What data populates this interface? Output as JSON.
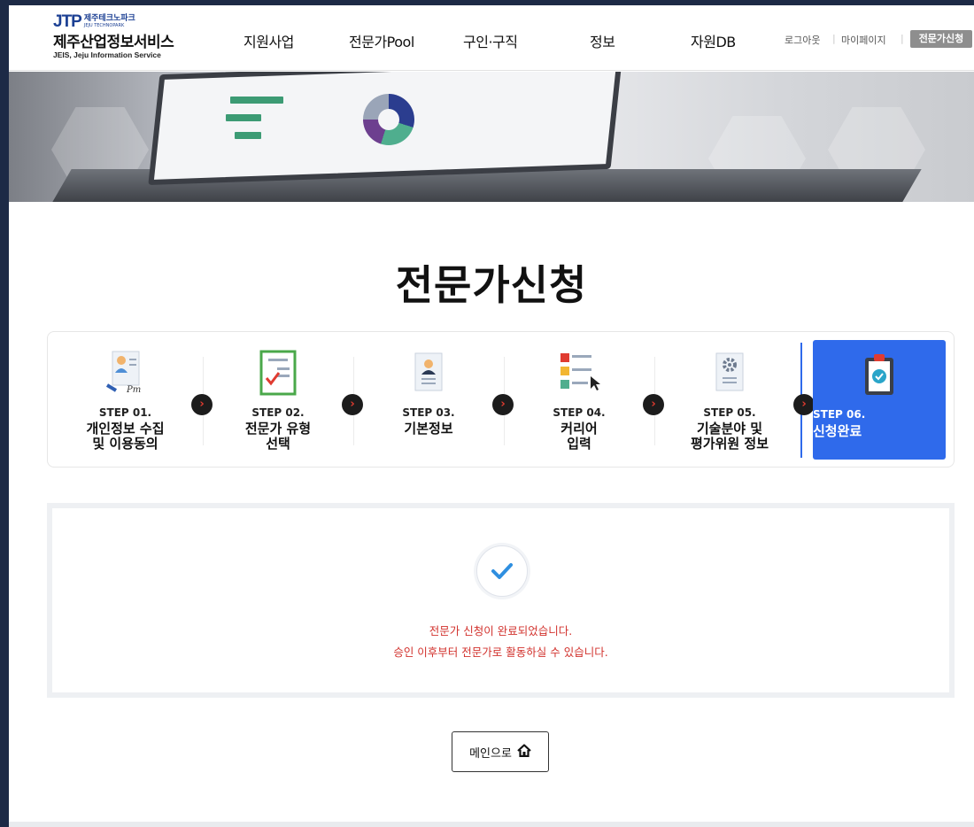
{
  "header": {
    "logo": {
      "jtp": "JTP",
      "park_kr": "제주테크노파크",
      "park_en": "JEJU TECHNOPARK",
      "name": "제주산업정보서비스",
      "sub": "JEIS, Jeju Information Service"
    },
    "nav": [
      {
        "label": "지원사업"
      },
      {
        "label": "전문가Pool"
      },
      {
        "label": "구인·구직"
      },
      {
        "label": "정보"
      },
      {
        "label": "자원DB"
      }
    ],
    "util": {
      "logout": "로그아웃",
      "mypage": "마이페이지",
      "apply": "전문가신청"
    }
  },
  "page_title": "전문가신청",
  "steps": [
    {
      "num": "STEP 01.",
      "label": "개인정보 수집\n및 이용동의",
      "icon": "consent-document-icon"
    },
    {
      "num": "STEP 02.",
      "label": "전문가 유형\n선택",
      "icon": "checklist-icon"
    },
    {
      "num": "STEP 03.",
      "label": "기본정보",
      "icon": "profile-card-icon"
    },
    {
      "num": "STEP 04.",
      "label": "커리어\n입력",
      "icon": "career-list-icon"
    },
    {
      "num": "STEP 05.",
      "label": "기술분야 및\n평가위원 정보",
      "icon": "gear-document-icon"
    },
    {
      "num": "STEP 06.",
      "label": "신청완료",
      "icon": "clipboard-check-icon",
      "active": true
    }
  ],
  "result": {
    "line1": "전문가 신청이 완료되었습니다.",
    "line2": "승인 이후부터 전문가로 활동하실 수 있습니다."
  },
  "main_button": {
    "label": "메인으로",
    "icon": "home-icon"
  },
  "colors": {
    "accent": "#2f6aeb",
    "message": "#d2322d",
    "arrow": "#e03b30"
  }
}
